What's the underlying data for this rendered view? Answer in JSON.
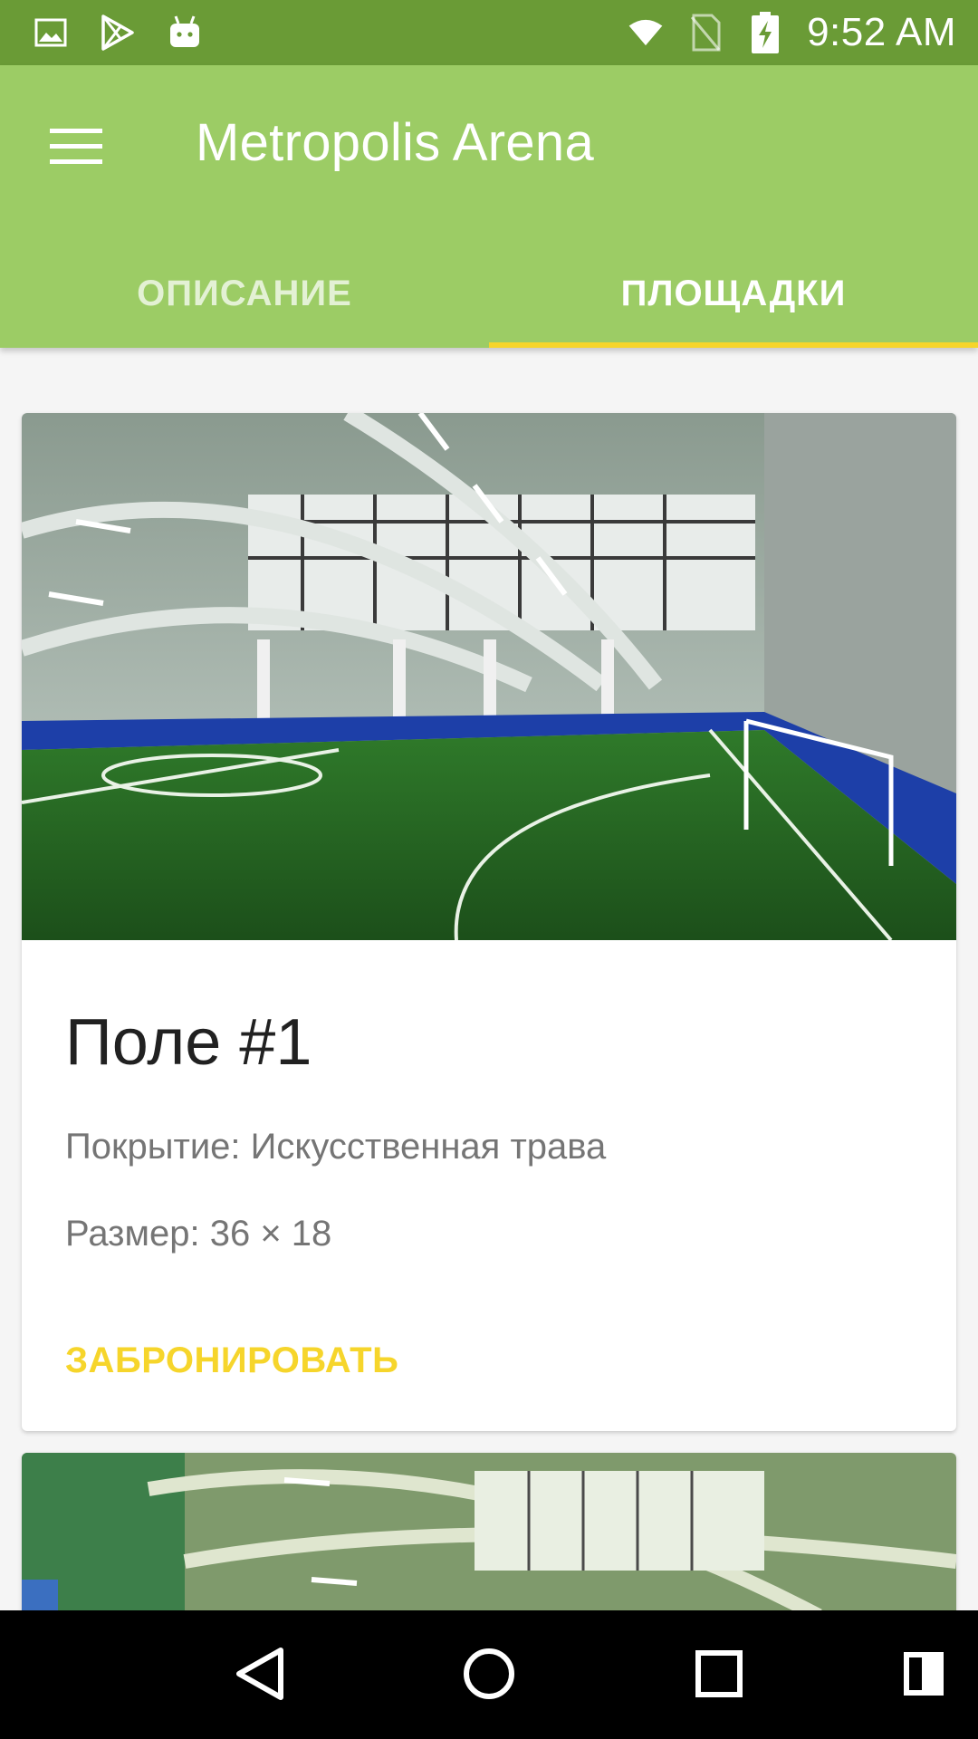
{
  "status_bar": {
    "time": "9:52 AM",
    "left_icons": [
      "image-icon",
      "play-store-icon",
      "android-icon"
    ],
    "right_icons": [
      "wifi-icon",
      "no-sim-icon",
      "battery-charging-icon"
    ]
  },
  "app_bar": {
    "title": "Metropolis Arena",
    "menu_icon": "hamburger-menu-icon",
    "color": "#9ccc65"
  },
  "tabs": [
    {
      "label": "ОПИСАНИЕ",
      "active": false
    },
    {
      "label": "ПЛОЩАДКИ",
      "active": true
    }
  ],
  "accent_color": "#f6d52b",
  "fields": [
    {
      "title": "Поле #1",
      "surface": "Покрытие: Искусственная трава",
      "size": "Размер: 36 × 18",
      "book_label": "ЗАБРОНИРОВАТЬ"
    }
  ],
  "nav_bar": {
    "icons": [
      "back-icon",
      "home-icon",
      "recents-icon",
      "split-screen-icon"
    ]
  }
}
